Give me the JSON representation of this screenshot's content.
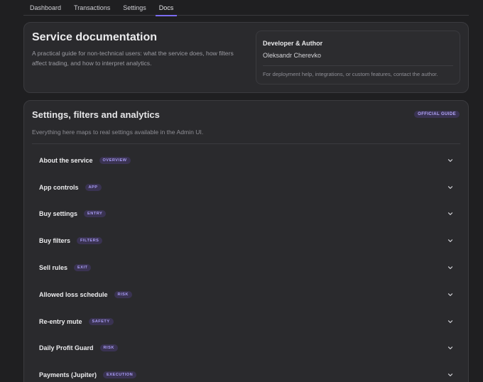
{
  "nav": {
    "tabs": [
      {
        "label": "Dashboard"
      },
      {
        "label": "Transactions"
      },
      {
        "label": "Settings"
      },
      {
        "label": "Docs"
      }
    ],
    "active_index": 3
  },
  "header": {
    "title": "Service documentation",
    "description": "A practical guide for non-technical users: what the service does, how filters affect trading, and how to interpret analytics."
  },
  "author": {
    "heading": "Developer & Author",
    "name": "Oleksandr Cherevko",
    "note": "For deployment help, integrations, or custom features, contact the author."
  },
  "guide": {
    "title": "Settings, filters and analytics",
    "badge": "OFFICIAL GUIDE",
    "subtitle": "Everything here maps to real settings available in the Admin UI.",
    "items": [
      {
        "label": "About the service",
        "tag": "OVERVIEW"
      },
      {
        "label": "App controls",
        "tag": "APP"
      },
      {
        "label": "Buy settings",
        "tag": "ENTRY"
      },
      {
        "label": "Buy filters",
        "tag": "FILTERS"
      },
      {
        "label": "Sell rules",
        "tag": "EXIT"
      },
      {
        "label": "Allowed loss schedule",
        "tag": "RISK"
      },
      {
        "label": "Re-entry mute",
        "tag": "SAFETY"
      },
      {
        "label": "Daily Profit Guard",
        "tag": "RISK"
      },
      {
        "label": "Payments (Jupiter)",
        "tag": "EXECUTION"
      }
    ]
  },
  "colors": {
    "accent": "#7b6cf0",
    "background": "#1f1f21",
    "card": "#2a2a2d"
  },
  "icons": {
    "accordion_toggle": "chevron-down-icon"
  }
}
